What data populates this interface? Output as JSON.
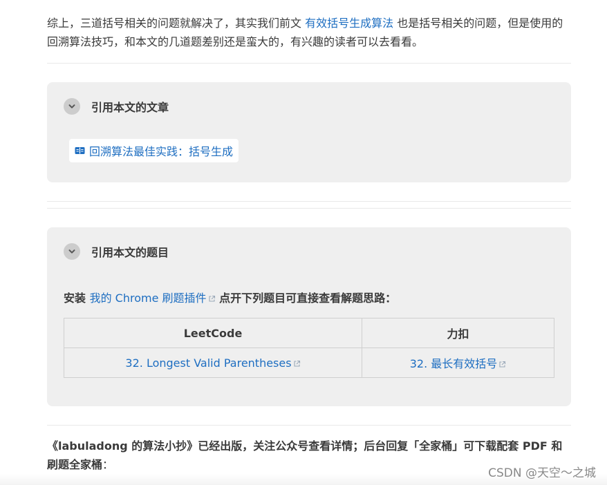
{
  "intro": {
    "text_before": "综上，三道括号相关的问题就解决了，其实我们前文 ",
    "link": "有效括号生成算法",
    "text_after": " 也是括号相关的问题，但是使用的回溯算法技巧，和本文的几道题差别还是蛮大的，有兴趣的读者可以去看看。"
  },
  "articles_card": {
    "title": "引用本文的文章",
    "items": [
      {
        "label": "回溯算法最佳实践：括号生成",
        "icon": "book-icon"
      }
    ]
  },
  "problems_card": {
    "title": "引用本文的题目",
    "install_prefix": "安装 ",
    "install_link": "我的 Chrome 刷题插件",
    "install_suffix": " 点开下列题目可直接查看解题思路：",
    "table": {
      "headers": [
        "LeetCode",
        "力扣"
      ],
      "rows": [
        [
          "32. Longest Valid Parentheses",
          "32. 最长有效括号"
        ]
      ]
    }
  },
  "footer": {
    "line_bold": "《labuladong 的算法小抄》已经出版，关注公众号查看详情；后台回复「全家桶」可下载配套 PDF 和刷题全家桶",
    "line_tail": "："
  },
  "watermark": "CSDN @天空～之城",
  "colors": {
    "link": "#1e6ec1",
    "card_bg": "#efefef",
    "text": "#3a3a3a"
  }
}
